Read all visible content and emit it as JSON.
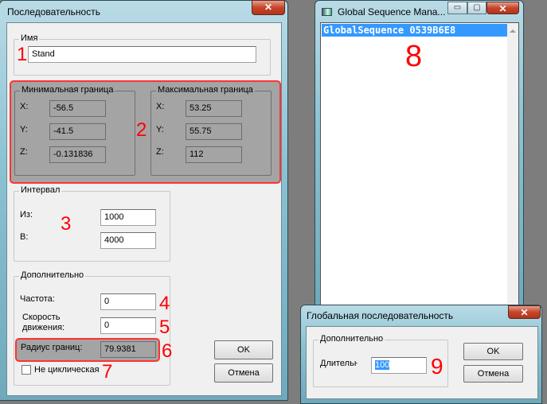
{
  "sequence_dialog": {
    "title": "Последовательность",
    "close_icon": "✕",
    "name_group": {
      "label": "Имя",
      "value": "Stand"
    },
    "min_bounds": {
      "label": "Минимальная граница",
      "x_label": "X:",
      "y_label": "Y:",
      "z_label": "Z:",
      "x": "-56.5",
      "y": "-41.5",
      "z": "-0.131836"
    },
    "max_bounds": {
      "label": "Максимальная граница",
      "x_label": "X:",
      "y_label": "Y:",
      "z_label": "Z:",
      "x": "53.25",
      "y": "55.75",
      "z": "112"
    },
    "interval": {
      "label": "Интервал",
      "from_label": "Из:",
      "from": "1000",
      "to_label": "В:",
      "to": "4000"
    },
    "extra": {
      "label": "Дополнительно",
      "rarity_label": "Частота:",
      "rarity": "0",
      "speed_label": "Скорость движения:",
      "speed": "0",
      "radius_label": "Радиус границ:",
      "radius": "79.9381",
      "nonlooping_label": "Не циклическая",
      "nonlooping_checked": false
    },
    "ok": "OK",
    "cancel": "Отмена"
  },
  "global_manager": {
    "title": "Global Sequence Mana...",
    "min_icon": "▭",
    "max_icon": "▢",
    "close_icon": "✕",
    "items": [
      "GlobalSequence 0539B6E8"
    ],
    "selected_color": "#3399ff"
  },
  "global_dialog": {
    "title": "Глобальная последовательность",
    "close_icon": "✕",
    "group_label": "Дополнительно",
    "duration_label": "Длительн",
    "duration": "100",
    "ok": "OK",
    "cancel": "Отмена"
  },
  "annotations": [
    "1",
    "2",
    "3",
    "4",
    "5",
    "6",
    "7",
    "8",
    "9"
  ]
}
